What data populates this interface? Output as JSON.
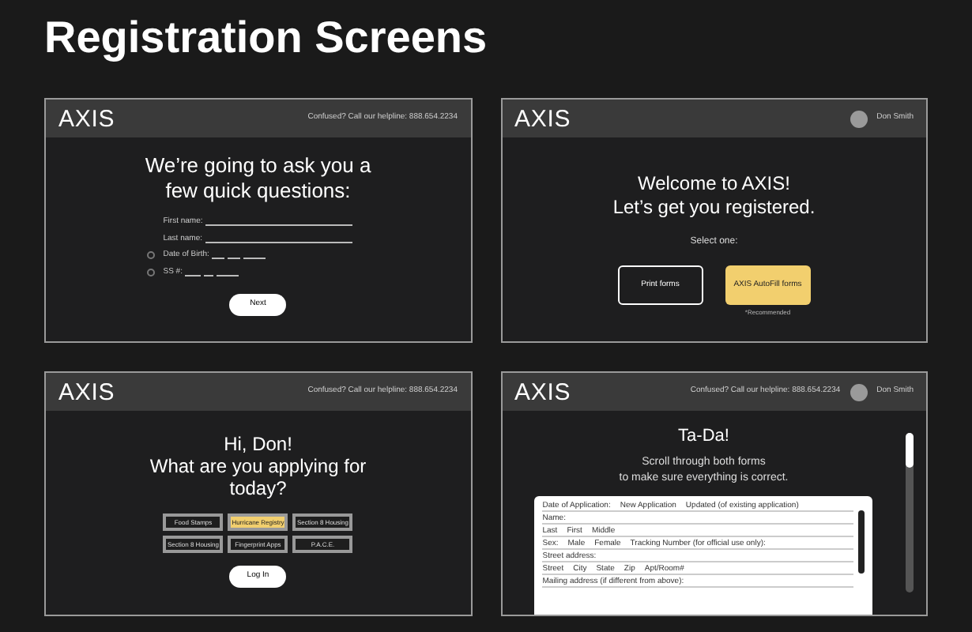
{
  "title": "Registration Screens",
  "screens": [
    {
      "kind": "questions",
      "logo": "AXIS",
      "helpline": "Confused? Call our helpline: 888.654.2234",
      "heading": "We’re going to ask you a\nfew quick questions:",
      "fields": [
        {
          "label": "First name:",
          "kind": "line"
        },
        {
          "label": "Last name:",
          "kind": "line"
        },
        {
          "label": "Date of Birth:",
          "kind": "date",
          "selected": false
        },
        {
          "label": "SS #:",
          "kind": "ssn",
          "selected": false
        }
      ],
      "button": "Next"
    },
    {
      "kind": "welcome",
      "logo": "AXIS",
      "user": "Don Smith",
      "heading": "Welcome to AXIS!\nLet’s get you registered.",
      "prompt": "Select one:",
      "options": [
        {
          "label": "Print forms",
          "selected": false
        },
        {
          "label": "AXIS AutoFill forms",
          "selected": true,
          "note": "*Recommended"
        }
      ]
    },
    {
      "kind": "programs",
      "logo": "AXIS",
      "helpline": "Confused? Call our helpline: 888.654.2234",
      "heading": "Hi, Don!\nWhat are you applying for\ntoday?",
      "options": [
        {
          "label": "Food Stamps",
          "selected": false
        },
        {
          "label": "Hurricane Registry",
          "selected": true
        },
        {
          "label": "Section 8 Housing",
          "selected": false
        },
        {
          "label": "Section 8 Housing",
          "selected": false
        },
        {
          "label": "Fingerprint Apps",
          "selected": false
        },
        {
          "label": "P.A.C.E.",
          "selected": false
        }
      ],
      "button": "Log In"
    },
    {
      "kind": "review",
      "logo": "AXIS",
      "helpline": "Confused? Call our helpline: 888.654.2234",
      "user": "Don Smith",
      "heading": "Ta-Da!",
      "subheading": "Scroll through both forms\nto make sure everything is correct.",
      "form": [
        [
          "Date of Application:",
          "New Application",
          "Updated (of existing application)"
        ],
        [
          "Name:"
        ],
        [
          "Last",
          "First",
          "Middle"
        ],
        [
          "Sex:",
          "Male",
          "Female",
          "Tracking Number (for official use only):"
        ],
        [
          "Street address:"
        ],
        [
          "Street",
          "City",
          "State",
          "Zip",
          "Apt/Room#"
        ],
        [
          "Mailing address (if different from above):"
        ]
      ]
    }
  ]
}
